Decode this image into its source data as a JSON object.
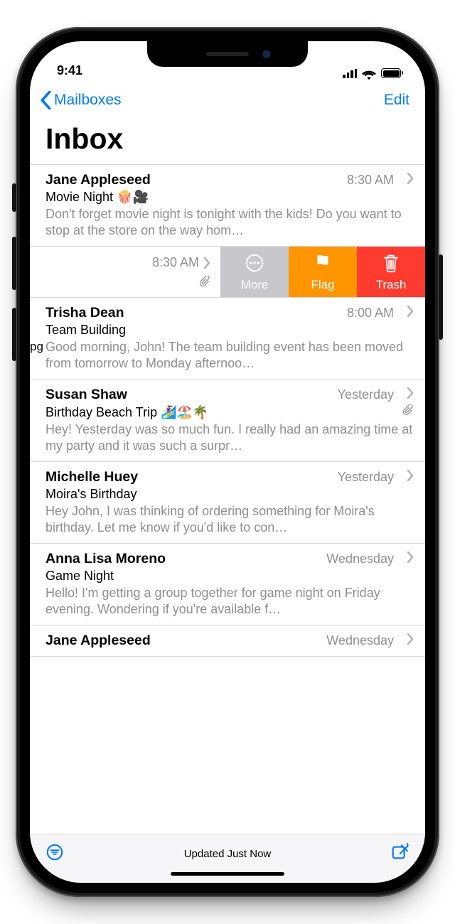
{
  "status": {
    "time": "9:41"
  },
  "nav": {
    "back_label": "Mailboxes",
    "edit_label": "Edit"
  },
  "page_title": "Inbox",
  "stray_text": "pg",
  "toolbar": {
    "status": "Updated Just Now"
  },
  "swipe": {
    "more": "More",
    "flag": "Flag",
    "trash": "Trash"
  },
  "messages": [
    {
      "sender": "Jane Appleseed",
      "time": "8:30 AM",
      "subject": "Movie Night 🍿🎥",
      "preview": "Don't forget movie night is tonight with the kids! Do you want to stop at the store on the way hom…",
      "attachment": false
    },
    {
      "sender": "",
      "time": "8:30 AM",
      "subject": "",
      "preview": "",
      "attachment": true,
      "swiped": true
    },
    {
      "sender": "Trisha Dean",
      "time": "8:00 AM",
      "subject": "Team Building",
      "preview": "Good morning, John! The team building event has been moved from tomorrow to Monday afternoo…",
      "attachment": false
    },
    {
      "sender": "Susan Shaw",
      "time": "Yesterday",
      "subject": "Birthday Beach Trip 🏄‍♀️🏖️🌴",
      "preview": "Hey! Yesterday was so much fun. I really had an amazing time at my party and it was such a surpr…",
      "attachment": true
    },
    {
      "sender": "Michelle Huey",
      "time": "Yesterday",
      "subject": "Moira's Birthday",
      "preview": "Hey John, I was thinking of ordering something for Moira's birthday. Let me know if you'd like to con…",
      "attachment": false
    },
    {
      "sender": "Anna Lisa Moreno",
      "time": "Wednesday",
      "subject": "Game Night",
      "preview": "Hello! I'm getting a group together for game night on Friday evening. Wondering if you're available f…",
      "attachment": false
    },
    {
      "sender": "Jane Appleseed",
      "time": "Wednesday",
      "subject": "",
      "preview": "",
      "attachment": false
    }
  ]
}
